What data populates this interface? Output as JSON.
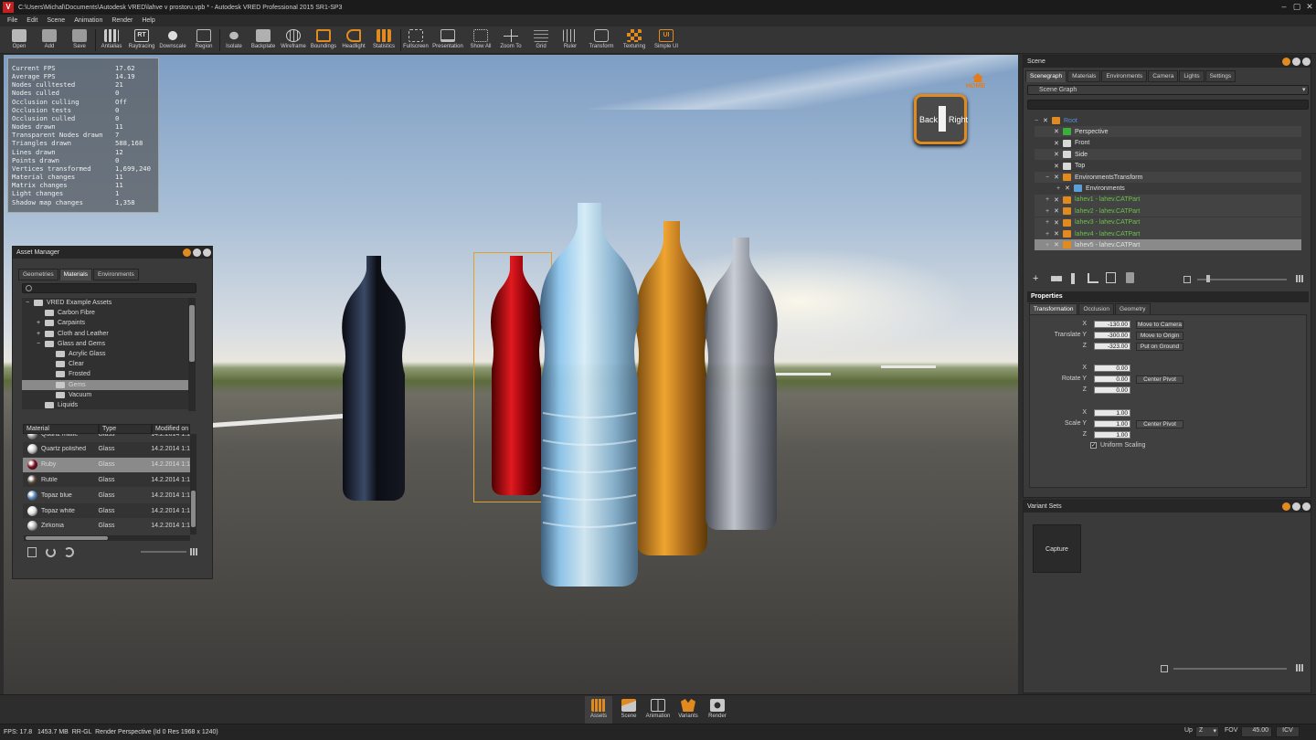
{
  "window": {
    "title": "C:\\Users\\Michal\\Documents\\Autodesk VRED\\lahve v prostoru.vpb * - Autodesk VRED Professional 2015 SR1-SP3",
    "min": "–",
    "max": "▢",
    "close": "✕"
  },
  "menu": [
    "File",
    "Edit",
    "Scene",
    "Animation",
    "Render",
    "Help"
  ],
  "toolbar": [
    {
      "label": "Open",
      "icon": "folder-open-icon"
    },
    {
      "label": "Add",
      "icon": "add-file-icon"
    },
    {
      "label": "Save",
      "icon": "save-icon"
    },
    {
      "label": "Antialias",
      "icon": "antialias-icon"
    },
    {
      "label": "Raytracing",
      "icon": "raytracing-icon",
      "glyph": "RT"
    },
    {
      "label": "Downscale",
      "icon": "downscale-icon"
    },
    {
      "label": "Region",
      "icon": "region-icon"
    },
    {
      "label": "Isolate",
      "icon": "isolate-icon"
    },
    {
      "label": "Backplate",
      "icon": "backplate-icon"
    },
    {
      "label": "Wireframe",
      "icon": "wireframe-icon"
    },
    {
      "label": "Boundings",
      "icon": "boundings-icon"
    },
    {
      "label": "Headlight",
      "icon": "headlight-icon"
    },
    {
      "label": "Statistics",
      "icon": "statistics-icon"
    },
    {
      "label": "Fullscreen",
      "icon": "fullscreen-icon"
    },
    {
      "label": "Presentation",
      "icon": "presentation-icon"
    },
    {
      "label": "Show All",
      "icon": "show-all-icon"
    },
    {
      "label": "Zoom To",
      "icon": "zoom-to-icon"
    },
    {
      "label": "Grid",
      "icon": "grid-icon"
    },
    {
      "label": "Ruler",
      "icon": "ruler-icon"
    },
    {
      "label": "Transform",
      "icon": "transform-icon"
    },
    {
      "label": "Texturing",
      "icon": "texturing-icon"
    },
    {
      "label": "Simple UI",
      "icon": "simple-ui-icon",
      "glyph": "UI"
    }
  ],
  "stats": [
    {
      "label": "Current FPS",
      "value": "17.62"
    },
    {
      "label": "Average FPS",
      "value": "14.19"
    },
    {
      "label": "Nodes culltested",
      "value": "21"
    },
    {
      "label": "Nodes culled",
      "value": "0"
    },
    {
      "label": "Occlusion culling",
      "value": "Off"
    },
    {
      "label": "Occlusion tests",
      "value": "0"
    },
    {
      "label": "Occlusion culled",
      "value": "0"
    },
    {
      "label": "Nodes drawn",
      "value": "11"
    },
    {
      "label": "Transparent Nodes drawn",
      "value": "7"
    },
    {
      "label": "Triangles drawn",
      "value": "588,168"
    },
    {
      "label": "Lines drawn",
      "value": "12"
    },
    {
      "label": "Points drawn",
      "value": "0"
    },
    {
      "label": "Vertices transformed",
      "value": "1,699,240"
    },
    {
      "label": "Material changes",
      "value": "11"
    },
    {
      "label": "Matrix changes",
      "value": "11"
    },
    {
      "label": "Light changes",
      "value": "1"
    },
    {
      "label": "Shadow map changes",
      "value": "1,358"
    }
  ],
  "navcube": {
    "home": "HOME",
    "back": "Back",
    "right": "Right"
  },
  "asset_manager": {
    "title": "Asset Manager",
    "tabs": [
      "Geometries",
      "Materials",
      "Environments"
    ],
    "active_tab": "Materials",
    "tree": [
      {
        "label": "VRED Example Assets",
        "level": 0,
        "toggle": "−"
      },
      {
        "label": "Carbon Fibre",
        "level": 1,
        "toggle": ""
      },
      {
        "label": "Carpaints",
        "level": 1,
        "toggle": "+"
      },
      {
        "label": "Cloth and Leather",
        "level": 1,
        "toggle": "+"
      },
      {
        "label": "Glass and Gems",
        "level": 1,
        "toggle": "−"
      },
      {
        "label": "Acrylic Glass",
        "level": 2,
        "toggle": ""
      },
      {
        "label": "Clear",
        "level": 2,
        "toggle": ""
      },
      {
        "label": "Frosted",
        "level": 2,
        "toggle": ""
      },
      {
        "label": "Gems",
        "level": 2,
        "toggle": "",
        "selected": true
      },
      {
        "label": "Vacuum",
        "level": 2,
        "toggle": ""
      },
      {
        "label": "Liquids",
        "level": 1,
        "toggle": ""
      }
    ],
    "columns": [
      "Material",
      "Type",
      "Modified on"
    ],
    "rows": [
      {
        "name": "Quartz matte",
        "type": "Glass",
        "modified": "14.2.2014 1:1",
        "color": "#9a9a9a"
      },
      {
        "name": "Quartz polished",
        "type": "Glass",
        "modified": "14.2.2014 1:1",
        "color": "#cfcfcf"
      },
      {
        "name": "Ruby",
        "type": "Glass",
        "modified": "14.2.2014 1:1",
        "color": "#7a1020",
        "selected": true
      },
      {
        "name": "Rutile",
        "type": "Glass",
        "modified": "14.2.2014 1:1",
        "color": "#5a4a3a"
      },
      {
        "name": "Topaz blue",
        "type": "Glass",
        "modified": "14.2.2014 1:1",
        "color": "#5f88b8"
      },
      {
        "name": "Topaz white",
        "type": "Glass",
        "modified": "14.2.2014 1:1",
        "color": "#e0e0e0"
      },
      {
        "name": "Zirkonia",
        "type": "Glass",
        "modified": "14.2.2014 1:1",
        "color": "#b8b8b8"
      }
    ]
  },
  "scene": {
    "title": "Scene",
    "tabs": [
      "Scenegraph",
      "Materials",
      "Environments",
      "Camera",
      "Lights",
      "Settings"
    ],
    "active_tab": "Scenegraph",
    "dropdown": "Scene Graph",
    "nodes": [
      {
        "label": "Root",
        "level": 0,
        "color": "#5a8fe0",
        "icon": "#e08a20",
        "expand": "−"
      },
      {
        "label": "Perspective",
        "level": 1,
        "color": "#e0e0e0",
        "icon": "#3cae3c",
        "expand": ""
      },
      {
        "label": "Front",
        "level": 1,
        "color": "#e0e0e0",
        "icon": "#d8d8d8",
        "expand": ""
      },
      {
        "label": "Side",
        "level": 1,
        "color": "#e0e0e0",
        "icon": "#d8d8d8",
        "expand": ""
      },
      {
        "label": "Top",
        "level": 1,
        "color": "#e0e0e0",
        "icon": "#d8d8d8",
        "expand": ""
      },
      {
        "label": "EnvironmentsTransform",
        "level": 1,
        "color": "#e0e0e0",
        "icon": "#e08a20",
        "expand": "−"
      },
      {
        "label": "Environments",
        "level": 2,
        "color": "#e0e0e0",
        "icon": "#5a9fd8",
        "expand": "+"
      },
      {
        "label": "lahev1 - lahev.CATPart",
        "level": 1,
        "color": "#6cc24a",
        "icon": "#e08a20",
        "expand": "+"
      },
      {
        "label": "lahev2 - lahev.CATPart",
        "level": 1,
        "color": "#6cc24a",
        "icon": "#e08a20",
        "expand": "+"
      },
      {
        "label": "lahev3 - lahev.CATPart",
        "level": 1,
        "color": "#6cc24a",
        "icon": "#e08a20",
        "expand": "+"
      },
      {
        "label": "lahev4 - lahev.CATPart",
        "level": 1,
        "color": "#6cc24a",
        "icon": "#e08a20",
        "expand": "+"
      },
      {
        "label": "lahev5 - lahev.CATPart",
        "level": 1,
        "color": "#e0e0e0",
        "icon": "#e08a20",
        "expand": "+",
        "selected": true
      }
    ]
  },
  "properties": {
    "title": "Properties",
    "tabs": [
      "Transformation",
      "Occlusion",
      "Geometry"
    ],
    "translate": {
      "label": "Translate",
      "x": "-130.00",
      "y": "-300.00",
      "z": "-323.00"
    },
    "rotate": {
      "label": "Rotate",
      "x": "0.00",
      "y": "0.00",
      "z": "0.00"
    },
    "scale": {
      "label": "Scale",
      "x": "1.00",
      "y": "1.00",
      "z": "1.00"
    },
    "buttons": {
      "move_to_camera": "Move to Camera",
      "move_to_origin": "Move to Origin",
      "put_on_ground": "Put on Ground",
      "center_pivot": "Center Pivot"
    },
    "uniform_scaling": "Uniform Scaling"
  },
  "variant_sets": {
    "title": "Variant Sets",
    "capture": "Capture"
  },
  "bottom_tabs": [
    {
      "label": "Assets",
      "icon": "assets-icon"
    },
    {
      "label": "Scene",
      "icon": "scene-icon"
    },
    {
      "label": "Animation",
      "icon": "animation-icon"
    },
    {
      "label": "Variants",
      "icon": "variants-icon"
    },
    {
      "label": "Render",
      "icon": "render-camera-icon"
    }
  ],
  "status": {
    "left": "FPS: 17.8   1453.7 MB  RR-GL  Render Perspective (Id 0 Res 1968 x 1240)",
    "up_label": "Up",
    "up_value": "Z",
    "fov_label": "FOV",
    "fov_value": "45.00",
    "icv": "ICV"
  },
  "colors": {
    "accent": "#e08a20",
    "selection": "#8a8a8a",
    "panel": "#3a3a3a"
  }
}
